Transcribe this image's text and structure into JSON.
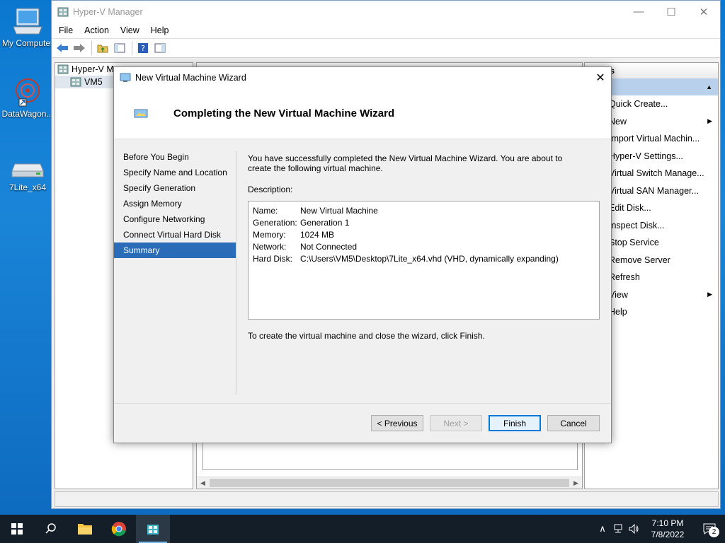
{
  "desktop": {
    "icons": [
      {
        "label": "My Computer",
        "icon": "computer-icon"
      },
      {
        "label": "DataWagon...",
        "icon": "datawagon-shortcut-icon"
      },
      {
        "label": "7Lite_x64",
        "icon": "drive-icon"
      }
    ]
  },
  "hyperv": {
    "title": "Hyper-V Manager",
    "menu": [
      "File",
      "Action",
      "View",
      "Help"
    ],
    "tree": {
      "root": "Hyper-V M",
      "child": "VM5"
    },
    "actions": {
      "header": "ns",
      "items": [
        "Quick Create...",
        "New",
        "Import Virtual Machin...",
        "Hyper-V Settings...",
        "Virtual Switch Manage...",
        "Virtual SAN Manager...",
        "Edit Disk...",
        "Inspect Disk...",
        "Stop Service",
        "Remove Server",
        "Refresh",
        "View",
        "Help"
      ]
    }
  },
  "wizard": {
    "title": "New Virtual Machine Wizard",
    "header": "Completing the New Virtual Machine Wizard",
    "steps": [
      "Before You Begin",
      "Specify Name and Location",
      "Specify Generation",
      "Assign Memory",
      "Configure Networking",
      "Connect Virtual Hard Disk",
      "Summary"
    ],
    "active_step": "Summary",
    "intro": "You have successfully completed the New Virtual Machine Wizard. You are about to create the following virtual machine.",
    "description_label": "Description:",
    "description": [
      {
        "key": "Name:",
        "value": "New Virtual Machine"
      },
      {
        "key": "Generation:",
        "value": "Generation 1"
      },
      {
        "key": "Memory:",
        "value": "1024 MB"
      },
      {
        "key": "Network:",
        "value": "Not Connected"
      },
      {
        "key": "Hard Disk:",
        "value": "C:\\Users\\VM5\\Desktop\\7Lite_x64.vhd (VHD, dynamically expanding)"
      }
    ],
    "finish_note": "To create the virtual machine and close the wizard, click Finish.",
    "buttons": {
      "previous": "< Previous",
      "next": "Next >",
      "finish": "Finish",
      "cancel": "Cancel"
    }
  },
  "taskbar": {
    "time": "7:10 PM",
    "date": "7/8/2022",
    "notifications": "2"
  },
  "colors": {
    "accent": "#2a6cb8",
    "desktop": "#0b78d0",
    "taskbar": "#141e29"
  }
}
